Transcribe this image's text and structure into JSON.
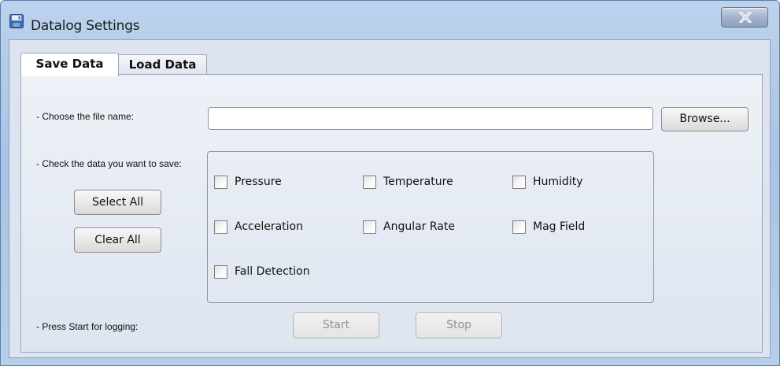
{
  "window": {
    "title": "Datalog Settings",
    "close_label": "X",
    "icons": {
      "app": "floppy-disk-icon",
      "close": "close-icon"
    }
  },
  "tabs": [
    {
      "label": "Save Data",
      "selected": true
    },
    {
      "label": "Load Data",
      "selected": false
    }
  ],
  "save_panel": {
    "file_label": "- Choose the file name:",
    "file_value": "",
    "browse_label": "Browse...",
    "check_label": "- Check the data you want to save:",
    "select_all_label": "Select All",
    "clear_all_label": "Clear All",
    "checkboxes": [
      {
        "label": "Pressure",
        "checked": false
      },
      {
        "label": "Temperature",
        "checked": false
      },
      {
        "label": "Humidity",
        "checked": false
      },
      {
        "label": "Acceleration",
        "checked": false
      },
      {
        "label": "Angular Rate",
        "checked": false
      },
      {
        "label": "Mag Field",
        "checked": false
      },
      {
        "label": "Fall Detection",
        "checked": false
      }
    ],
    "start_label_text": "- Press Start for logging:",
    "start_button": "Start",
    "stop_button": "Stop"
  }
}
